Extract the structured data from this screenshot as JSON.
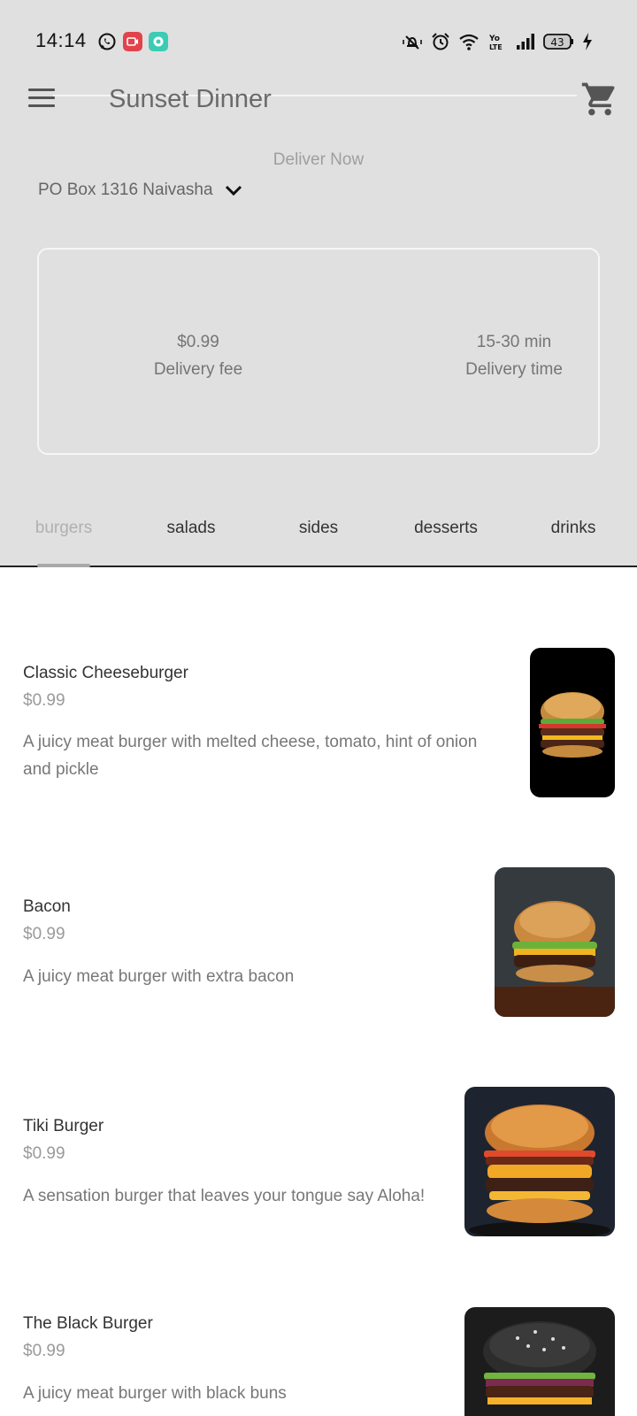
{
  "status_bar": {
    "time": "14:14",
    "battery": "43"
  },
  "app_bar": {
    "title": "Sunset Dinner"
  },
  "delivery": {
    "mode": "Deliver Now",
    "address": "PO Box 1316 Naivasha"
  },
  "info_card": {
    "fee_value": "$0.99",
    "fee_label": "Delivery fee",
    "time_value": "15-30 min",
    "time_label": "Delivery time"
  },
  "tabs": [
    {
      "label": "burgers",
      "active": true
    },
    {
      "label": "salads",
      "active": false
    },
    {
      "label": "sides",
      "active": false
    },
    {
      "label": "desserts",
      "active": false
    },
    {
      "label": "drinks",
      "active": false
    }
  ],
  "menu_items": [
    {
      "name": "Classic Cheeseburger",
      "price": "$0.99",
      "description_line1": "A juicy meat burger with melted cheese, tomato, hint of onion",
      "description_line2": "and pickle",
      "image": "cheeseburger-photo"
    },
    {
      "name": "Bacon",
      "price": "$0.99",
      "description_line1": "A juicy meat burger with extra bacon",
      "image": "bacon-burger-photo"
    },
    {
      "name": "Tiki Burger",
      "price": "$0.99",
      "description_line1": "A sensation burger that leaves your tongue say Aloha!",
      "image": "tiki-burger-photo"
    },
    {
      "name": "The Black Burger",
      "price": "$0.99",
      "description_line1": "A juicy meat burger with black buns",
      "image": "black-burger-photo"
    }
  ],
  "colors": {
    "header_bg": "#e0e0e0",
    "accent_indicator": "#a8a8a8"
  }
}
